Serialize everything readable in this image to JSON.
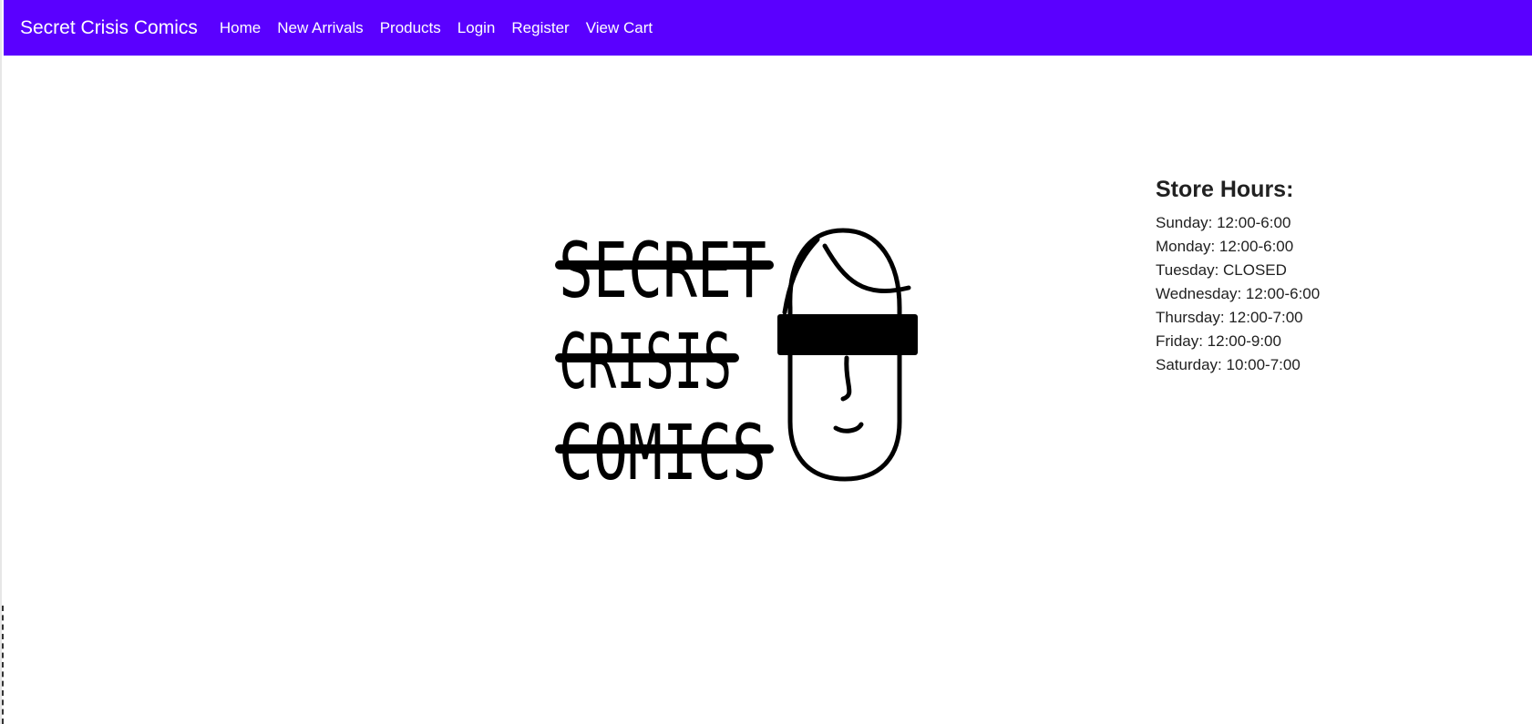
{
  "navbar": {
    "brand": "Secret Crisis Comics",
    "background_color": "#5a00ff",
    "links": [
      "Home",
      "New Arrivals",
      "Products",
      "Login",
      "Register",
      "View Cart"
    ]
  },
  "logo": {
    "words": [
      "SECRET",
      "CRISIS",
      "COMICS"
    ],
    "icon": "masked-face-icon"
  },
  "store_hours": {
    "title": "Store Hours:",
    "days": [
      "Sunday: 12:00-6:00",
      "Monday: 12:00-6:00",
      "Tuesday: CLOSED",
      "Wednesday: 12:00-6:00",
      "Thursday: 12:00-7:00",
      "Friday: 12:00-9:00",
      "Saturday: 10:00-7:00"
    ]
  }
}
